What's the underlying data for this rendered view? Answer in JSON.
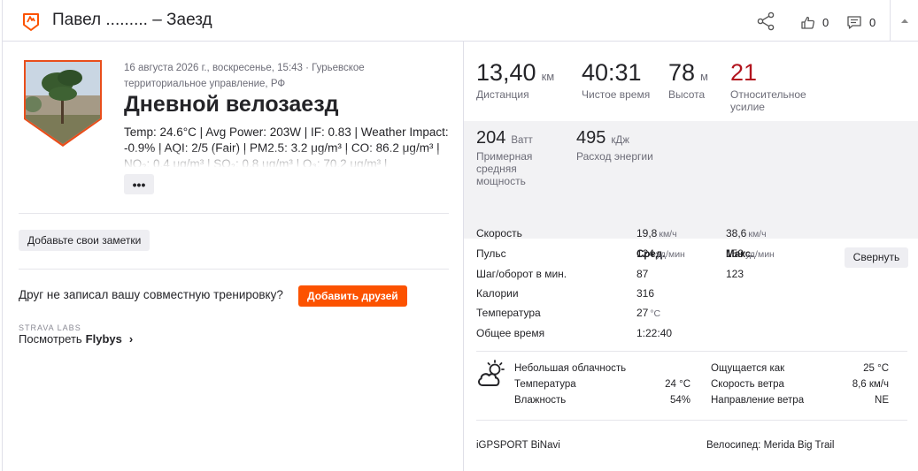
{
  "header": {
    "title": "Павел ......... – Заезд",
    "kudos_count": "0",
    "comments_count": "0"
  },
  "activity": {
    "meta_line1": "16 августа 2026 г., воскресенье, 15:43 · Гурьевское",
    "meta_line2": "территориальное управление, РФ",
    "name": "Дневной велозаезд",
    "description": "Temp: 24.6°C | Avg Power: 203W | IF: 0.83 | Weather Impact: -0.9% | AQI: 2/5 (Fair) | PM2.5: 3.2 μg/m³ | CO: 86.2 μg/m³ | NO₂: 0.4 μg/m³ | SO₂: 0.8 μg/m³ | O₃: 70.2 μg/m³ |",
    "more_label": "•••",
    "notes_button": "Добавьте свои заметки",
    "friend_prompt": "Друг не записал вашу совместную тренировку?",
    "add_friends_button": "Добавить друзей",
    "labs_label": "STRAVA LABS",
    "flybys_prefix": "Посмотреть",
    "flybys_word": "Flybys"
  },
  "primary_stats": [
    {
      "value": "13,40",
      "unit": "км",
      "label": "Дистанция"
    },
    {
      "value": "40:31",
      "unit": "",
      "label": "Чистое время"
    },
    {
      "value": "78",
      "unit": "м",
      "label": "Высота"
    },
    {
      "value": "21",
      "unit": "",
      "label": "Относительное усилие"
    }
  ],
  "secondary_stats": [
    {
      "value": "204",
      "unit": "Ватт",
      "label": "Примерная средняя мощность"
    },
    {
      "value": "495",
      "unit": "кДж",
      "label": "Расход энергии"
    }
  ],
  "table": {
    "avg_header": "Сред.",
    "max_header": "Макс.",
    "collapse_button": "Свернуть",
    "rows": [
      {
        "label": "Скорость",
        "avg": "19,8",
        "avg_unit": "км/ч",
        "max": "38,6",
        "max_unit": "км/ч"
      },
      {
        "label": "Пульс",
        "avg": "124",
        "avg_unit": "уд/мин",
        "max": "159",
        "max_unit": "уд/мин"
      },
      {
        "label": "Шаг/оборот в мин.",
        "avg": "87",
        "avg_unit": "",
        "max": "123",
        "max_unit": ""
      },
      {
        "label": "Калории",
        "avg": "316",
        "avg_unit": "",
        "max": "",
        "max_unit": ""
      },
      {
        "label": "Температура",
        "avg": "27",
        "avg_unit": "°C",
        "max": "",
        "max_unit": ""
      },
      {
        "label": "Общее время",
        "avg": "1:22:40",
        "avg_unit": "",
        "max": "",
        "max_unit": ""
      }
    ]
  },
  "weather": {
    "condition": "Небольшая облачность",
    "temp_label": "Температура",
    "temp_value": "24 °C",
    "humidity_label": "Влажность",
    "humidity_value": "54%",
    "feels_label": "Ощущается как",
    "feels_value": "25 °C",
    "wind_speed_label": "Скорость ветра",
    "wind_speed_value": "8,6 км/ч",
    "wind_dir_label": "Направление ветра",
    "wind_dir_value": "NE"
  },
  "gear": {
    "device": "iGPSPORT BiNavi",
    "bike_label": "Велосипед:",
    "bike_name": "Merida Big Trail"
  },
  "colors": {
    "brand_orange": "#fc5200",
    "effort_red": "#b2141e"
  }
}
